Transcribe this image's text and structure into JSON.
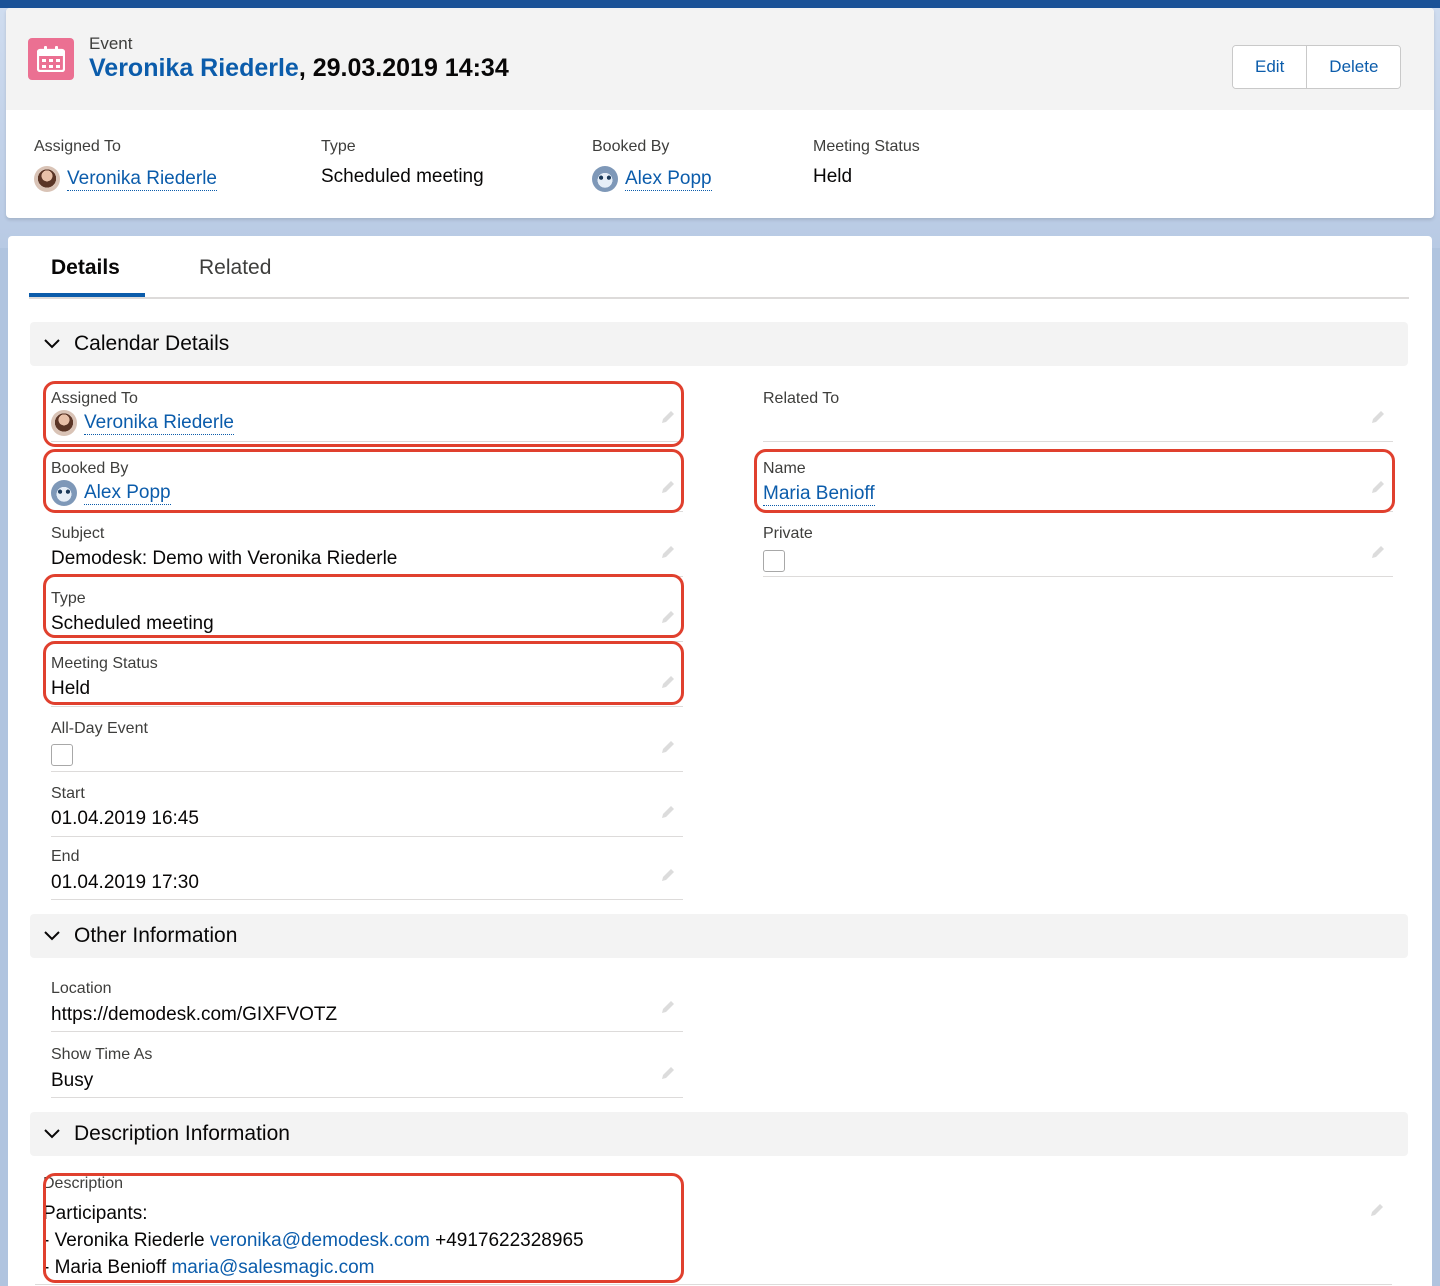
{
  "header": {
    "object_label": "Event",
    "title_name": "Veronika Riederle",
    "title_rest": ", 29.03.2019 14:34",
    "buttons": {
      "edit": "Edit",
      "delete": "Delete"
    },
    "icon": "calendar-icon",
    "icon_color": "#eb7092",
    "highlights": [
      {
        "label": "Assigned To",
        "value": "Veronika Riederle",
        "avatar": "user-avatar"
      },
      {
        "label": "Type",
        "value": "Scheduled meeting"
      },
      {
        "label": "Booked By",
        "value": "Alex Popp",
        "avatar": "bot-avatar"
      },
      {
        "label": "Meeting Status",
        "value": "Held"
      }
    ]
  },
  "tabs": [
    {
      "label": "Details",
      "active": true
    },
    {
      "label": "Related",
      "active": false
    }
  ],
  "sections": {
    "calendar": {
      "title": "Calendar Details",
      "left": [
        {
          "label": "Assigned To",
          "value": "Veronika Riederle"
        },
        {
          "label": "Booked By",
          "value": "Alex Popp"
        },
        {
          "label": "Subject",
          "value": "Demodesk: Demo with Veronika Riederle"
        },
        {
          "label": "Type",
          "value": "Scheduled meeting"
        },
        {
          "label": "Meeting Status",
          "value": "Held"
        },
        {
          "label": "All-Day Event",
          "checked": false
        },
        {
          "label": "Start",
          "value": "01.04.2019 16:45"
        },
        {
          "label": "End",
          "value": "01.04.2019 17:30"
        }
      ],
      "right": [
        {
          "label": "Related To",
          "value": ""
        },
        {
          "label": "Name",
          "value": "Maria Benioff"
        },
        {
          "label": "Private",
          "checked": false
        }
      ]
    },
    "other": {
      "title": "Other Information",
      "fields": [
        {
          "label": "Location",
          "value": "https://demodesk.com/GIXFVOTZ"
        },
        {
          "label": "Show Time As",
          "value": "Busy"
        }
      ]
    },
    "description": {
      "title": "Description Information",
      "label": "Description",
      "line1": "Participants:",
      "p1_prefix": "- Veronika Riederle ",
      "p1_email": "veronika@demodesk.com",
      "p1_phone": " +4917622328965",
      "p2_prefix": "- Maria Benioff ",
      "p2_email": "maria@salesmagic.com"
    }
  },
  "colors": {
    "link": "#0b5cab",
    "highlight": "#e0402e",
    "tab_active": "#0b5cab"
  }
}
